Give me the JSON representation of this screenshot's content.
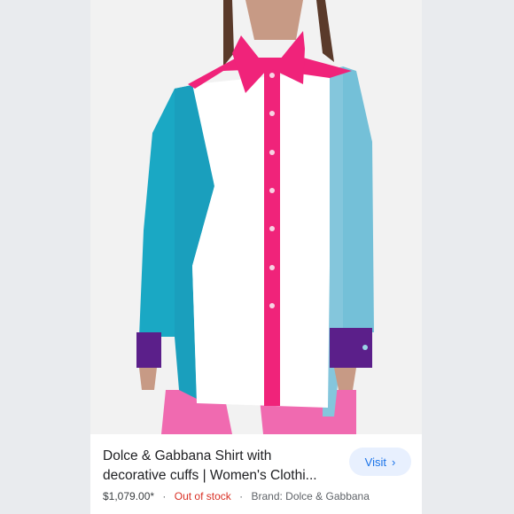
{
  "product": {
    "title": "Dolce & Gabbana Shirt with decorative cuffs | Women's Clothi...",
    "price": "$1,079.00*",
    "stock_status": "Out of stock",
    "brand": "Brand: Dolce & Gabbana",
    "separator": "·"
  },
  "actions": {
    "visit_label": "Visit",
    "visit_icon": "chevron-right-icon"
  },
  "colors": {
    "link_blue": "#1a73e8",
    "out_of_stock_red": "#d93025",
    "shirt_pink": "#f0237a",
    "shirt_teal": "#1aa8c4",
    "shirt_lightblue": "#74c0d8",
    "sequin_purple": "#5b1f8a"
  }
}
